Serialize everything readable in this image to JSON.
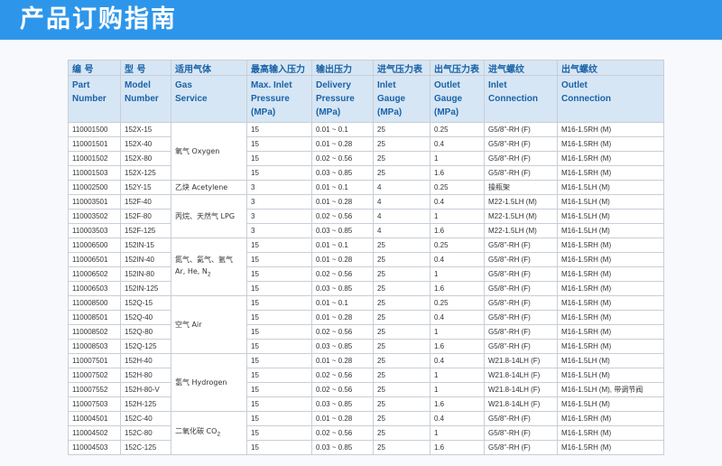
{
  "banner": {
    "title": "产品订购指南"
  },
  "table": {
    "headers_cn": [
      "编 号",
      "型 号",
      "适用气体",
      "最高输入压力",
      "输出压力",
      "进气压力表",
      "出气压力表",
      "进气螺纹",
      "出气螺纹"
    ],
    "headers_en": [
      [
        "Part",
        "Number"
      ],
      [
        "Model",
        "Number"
      ],
      [
        "Gas",
        "Service"
      ],
      [
        "Max. Inlet",
        "Pressure",
        "(MPa)"
      ],
      [
        "Delivery",
        "Pressure",
        "(MPa)"
      ],
      [
        "Inlet",
        "Gauge",
        "(MPa)"
      ],
      [
        "Outlet",
        "Gauge",
        "(MPa)"
      ],
      [
        "Inlet",
        "Connection"
      ],
      [
        "Outlet",
        "Connection"
      ]
    ],
    "groups": [
      {
        "gas": "氧气 Oxygen",
        "rows": [
          [
            "110001500",
            "152X-15",
            "15",
            "0.01 ~ 0.1",
            "25",
            "0.25",
            "G5/8\"-RH (F)",
            "M16-1.5RH (M)"
          ],
          [
            "110001501",
            "152X-40",
            "15",
            "0.01 ~ 0.28",
            "25",
            "0.4",
            "G5/8\"-RH (F)",
            "M16-1.5RH (M)"
          ],
          [
            "110001502",
            "152X-80",
            "15",
            "0.02 ~ 0.56",
            "25",
            "1",
            "G5/8\"-RH (F)",
            "M16-1.5RH (M)"
          ],
          [
            "110001503",
            "152X-125",
            "15",
            "0.03 ~ 0.85",
            "25",
            "1.6",
            "G5/8\"-RH (F)",
            "M16-1.5RH (M)"
          ]
        ]
      },
      {
        "gas": "乙炔 Acetylene",
        "rows": [
          [
            "110002500",
            "152Y-15",
            "3",
            "0.01 ~ 0.1",
            "4",
            "0.25",
            "操瓶架",
            "M16-1.5LH (M)"
          ]
        ]
      },
      {
        "gas": "丙烷、天然气 LPG",
        "rows": [
          [
            "110003501",
            "152F-40",
            "3",
            "0.01 ~ 0.28",
            "4",
            "0.4",
            "M22-1.5LH (M)",
            "M16-1.5LH (M)"
          ],
          [
            "110003502",
            "152F-80",
            "3",
            "0.02 ~ 0.56",
            "4",
            "1",
            "M22-1.5LH (M)",
            "M16-1.5LH (M)"
          ],
          [
            "110003503",
            "152F-125",
            "3",
            "0.03 ~ 0.85",
            "4",
            "1.6",
            "M22-1.5LH (M)",
            "M16-1.5LH (M)"
          ]
        ]
      },
      {
        "gas": "氮气、氦气、氩气",
        "gas_line2": "Ar, He, N",
        "gas_sub": "2",
        "rows": [
          [
            "110006500",
            "152IN-15",
            "15",
            "0.01 ~ 0.1",
            "25",
            "0.25",
            "G5/8\"-RH (F)",
            "M16-1.5RH (M)"
          ],
          [
            "110006501",
            "152IN-40",
            "15",
            "0.01 ~ 0.28",
            "25",
            "0.4",
            "G5/8\"-RH (F)",
            "M16-1.5RH (M)"
          ],
          [
            "110006502",
            "152IN-80",
            "15",
            "0.02 ~ 0.56",
            "25",
            "1",
            "G5/8\"-RH (F)",
            "M16-1.5RH (M)"
          ],
          [
            "110006503",
            "152IN-125",
            "15",
            "0.03 ~ 0.85",
            "25",
            "1.6",
            "G5/8\"-RH (F)",
            "M16-1.5RH (M)"
          ]
        ]
      },
      {
        "gas": "空气 Air",
        "rows": [
          [
            "110008500",
            "152Q-15",
            "15",
            "0.01 ~ 0.1",
            "25",
            "0.25",
            "G5/8\"-RH (F)",
            "M16-1.5RH (M)"
          ],
          [
            "110008501",
            "152Q-40",
            "15",
            "0.01 ~ 0.28",
            "25",
            "0.4",
            "G5/8\"-RH (F)",
            "M16-1.5RH (M)"
          ],
          [
            "110008502",
            "152Q-80",
            "15",
            "0.02 ~ 0.56",
            "25",
            "1",
            "G5/8\"-RH (F)",
            "M16-1.5RH (M)"
          ],
          [
            "110008503",
            "152Q-125",
            "15",
            "0.03 ~ 0.85",
            "25",
            "1.6",
            "G5/8\"-RH (F)",
            "M16-1.5RH (M)"
          ]
        ]
      },
      {
        "gas": "氢气 Hydrogen",
        "rows": [
          [
            "110007501",
            "152H-40",
            "15",
            "0.01 ~ 0.28",
            "25",
            "0.4",
            "W21.8-14LH (F)",
            "M16-1.5LH (M)"
          ],
          [
            "110007502",
            "152H-80",
            "15",
            "0.02 ~ 0.56",
            "25",
            "1",
            "W21.8-14LH (F)",
            "M16-1.5LH (M)"
          ],
          [
            "110007552",
            "152H-80-V",
            "15",
            "0.02 ~ 0.56",
            "25",
            "1",
            "W21.8-14LH (F)",
            "M16-1.5LH (M), 带调节阀"
          ],
          [
            "110007503",
            "152H-125",
            "15",
            "0.03 ~ 0.85",
            "25",
            "1.6",
            "W21.8-14LH (F)",
            "M16-1.5LH (M)"
          ]
        ]
      },
      {
        "gas": "二氧化碳 CO",
        "gas_sub": "2",
        "rows": [
          [
            "110004501",
            "152C-40",
            "15",
            "0.01 ~ 0.28",
            "25",
            "0.4",
            "G5/8\"-RH (F)",
            "M16-1.5RH (M)"
          ],
          [
            "110004502",
            "152C-80",
            "15",
            "0.02 ~ 0.56",
            "25",
            "1",
            "G5/8\"-RH (F)",
            "M16-1.5RH (M)"
          ],
          [
            "110004503",
            "152C-125",
            "15",
            "0.03 ~ 0.85",
            "25",
            "1.6",
            "G5/8\"-RH (F)",
            "M16-1.5RH (M)"
          ]
        ]
      }
    ]
  }
}
